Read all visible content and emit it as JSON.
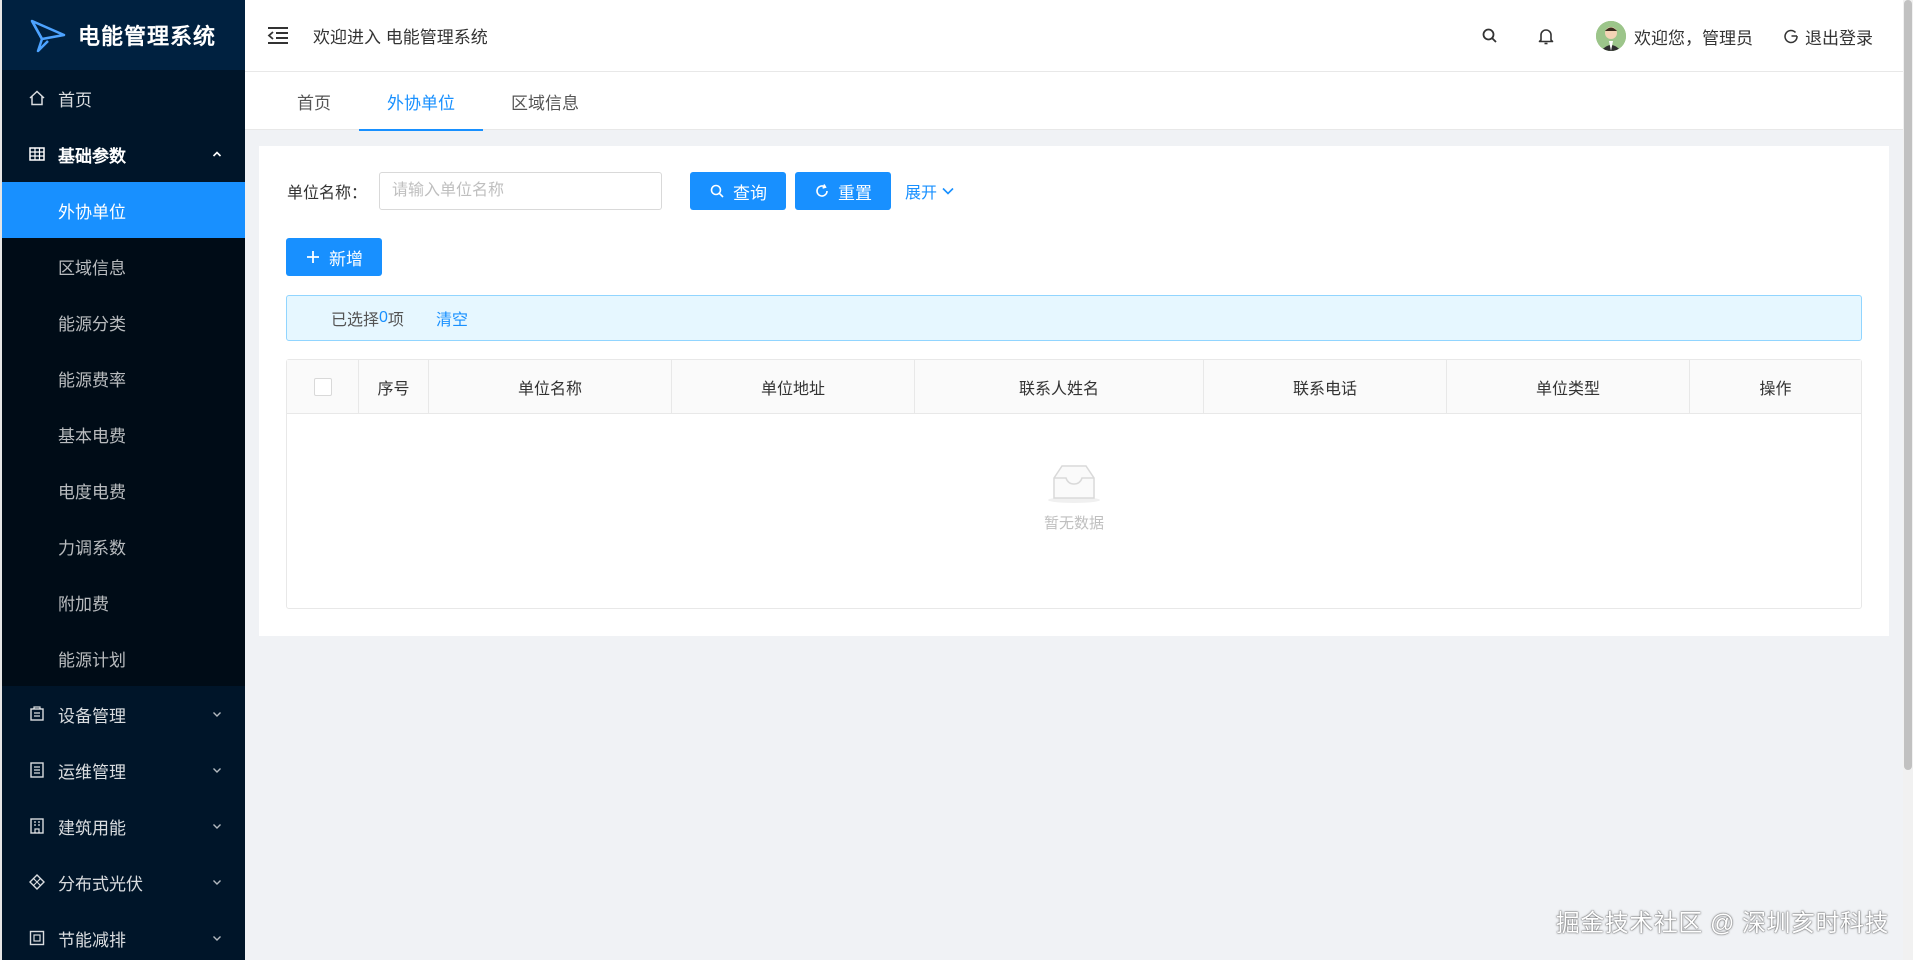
{
  "app": {
    "title": "电能管理系统"
  },
  "sidebar": {
    "home": "首页",
    "basic": {
      "label": "基础参数",
      "items": [
        "外协单位",
        "区域信息",
        "能源分类",
        "能源费率",
        "基本电费",
        "电度电费",
        "力调系数",
        "附加费",
        "能源计划"
      ],
      "active_index": 0
    },
    "groups": [
      {
        "label": "设备管理",
        "icon": "device-icon"
      },
      {
        "label": "运维管理",
        "icon": "ops-icon"
      },
      {
        "label": "建筑用能",
        "icon": "building-icon"
      },
      {
        "label": "分布式光伏",
        "icon": "solar-icon"
      },
      {
        "label": "节能减排",
        "icon": "saving-icon"
      }
    ]
  },
  "header": {
    "title": "欢迎进入 电能管理系统",
    "welcome": "欢迎您，管理员",
    "logout": "退出登录"
  },
  "tabs": [
    {
      "label": "首页"
    },
    {
      "label": "外协单位",
      "active": true
    },
    {
      "label": "区域信息"
    }
  ],
  "search": {
    "label": "单位名称：",
    "placeholder": "请输入单位名称",
    "value": "",
    "query_label": "查询",
    "reset_label": "重置",
    "expand_label": "展开"
  },
  "toolbar": {
    "add_label": "新增"
  },
  "selection": {
    "prefix": "已选择 ",
    "count": "0",
    "suffix": "项",
    "clear_label": "清空"
  },
  "table": {
    "columns": [
      "序号",
      "单位名称",
      "单位地址",
      "联系人姓名",
      "联系电话",
      "单位类型",
      "操作"
    ],
    "rows": [],
    "empty_text": "暂无数据"
  },
  "watermark": "掘金技术社区 @ 深圳亥时科技",
  "colors": {
    "primary": "#1890ff",
    "sidebar_bg": "#001529",
    "submenu_bg": "#000c17"
  }
}
